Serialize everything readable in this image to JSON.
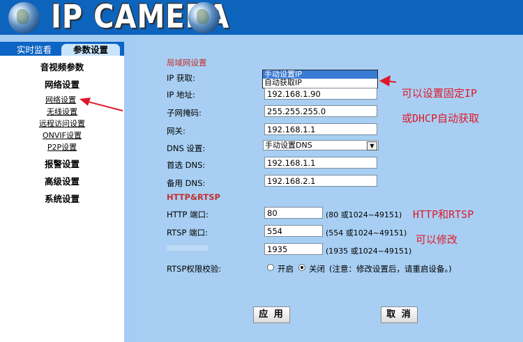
{
  "header": {
    "logo_text": "IP CAMERA"
  },
  "tabs": {
    "live": "实时监看",
    "params": "参数设置"
  },
  "sidebar": {
    "cat_av": "音视频参数",
    "cat_network": "网络设置",
    "sub_network": "网络设置",
    "sub_wireless": "无线设置",
    "sub_remote": "远程访问设置",
    "sub_onvif": "ONVIF设置",
    "sub_p2p": "P2P设置",
    "cat_alarm": "报警设置",
    "cat_advanced": "高级设置",
    "cat_system": "系统设置"
  },
  "lan": {
    "title": "局域网设置",
    "ip_mode_label": "IP 获取:",
    "ip_mode_options": [
      "手动设置IP",
      "自动获取IP"
    ],
    "ip_label": "IP 地址:",
    "ip_value": "192.168.1.90",
    "mask_label": "子网掩码:",
    "mask_value": "255.255.255.0",
    "gateway_label": "网关:",
    "gateway_value": "192.168.1.1",
    "dns_mode_label": "DNS 设置:",
    "dns_mode_value": "手动设置DNS",
    "dns1_label": "首选 DNS:",
    "dns1_value": "192.168.1.1",
    "dns2_label": "备用 DNS:",
    "dns2_value": "192.168.2.1"
  },
  "http": {
    "title": "HTTP&RTSP",
    "http_label": "HTTP 端口:",
    "http_value": "80",
    "http_note": "(80 或1024~49151)",
    "rtsp_label": "RTSP 端口:",
    "rtsp_value": "554",
    "rtsp_note": "(554 或1024~49151)",
    "third_value": "1935",
    "third_note": "(1935 或1024~49151)",
    "auth_label": "RTSP权限校验:",
    "auth_on": "开启",
    "auth_off": "关闭",
    "auth_note": "(注意：修改设置后，请重启设备。)"
  },
  "buttons": {
    "apply": "应 用",
    "cancel": "取 消"
  },
  "annotations": {
    "ip_line1": "可以设置固定IP",
    "ip_line2": "或DHCP自动获取",
    "http_line1": "HTTP和RTSP",
    "http_line2": "可以修改"
  },
  "colors": {
    "header_bg": "#0d64bd",
    "page_bg": "#a5cdf3",
    "section_title": "#c3302c",
    "annotation": "#e0182a"
  }
}
